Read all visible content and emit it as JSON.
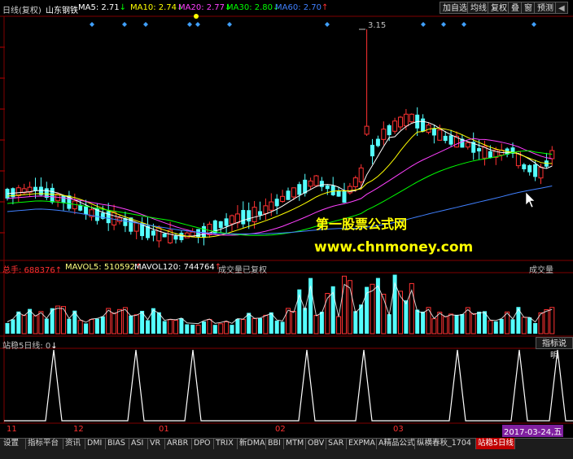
{
  "header": {
    "period": "日线(复权)",
    "stock_name": "山东钢铁",
    "ma": [
      {
        "label": "MA5: 2.71",
        "arrow": "↓",
        "color": "#ffffff"
      },
      {
        "label": "MA10: 2.74",
        "arrow": "↓",
        "color": "#ffff00"
      },
      {
        "label": "MA20: 2.77",
        "arrow": "↓",
        "color": "#ff40ff"
      },
      {
        "label": "MA30: 2.80",
        "arrow": "↓",
        "color": "#00ff00"
      },
      {
        "label": "MA60: 2.70",
        "arrow": "↑",
        "color": "#4080ff"
      }
    ],
    "buttons": [
      "加自选",
      "均线",
      "复权",
      "叠",
      "窗",
      "预测"
    ],
    "scroll_arrow": "◀"
  },
  "peak_label": "3.15",
  "watermark": {
    "line1": "第一股票公式网",
    "line2": "www.chnmoney.com"
  },
  "volume_panel": {
    "total": "总手: 688376",
    "total_arrow": "↑",
    "mavol5": "MAVOL5: 510592",
    "mavol5_arrow": "↑",
    "mavol120": "MAVOL120: 744764",
    "mavol120_arrow": "↑",
    "note": "成交量已复权",
    "right_label": "成交量"
  },
  "indicator_panel": {
    "label": "站稳5日线: 0",
    "arrow": "↓",
    "help_button": "指标说明"
  },
  "time_axis": {
    "labels": [
      "11",
      "12",
      "01",
      "02",
      "03"
    ],
    "current_date": "2017-03-24,五"
  },
  "tabs": [
    "设置",
    "指标平台",
    "资讯",
    "DMI",
    "BIAS",
    "ASI",
    "VR",
    "ARBR",
    "DPO",
    "TRIX",
    "新DMA",
    "BBI",
    "MTM",
    "OBV",
    "SAR",
    "EXPMA",
    "A精品公式",
    "纵横春秋_1704",
    "站稳5日线"
  ],
  "colors": {
    "up": "#ff3232",
    "down": "#54ffff",
    "grid": "#800000",
    "ma5": "#ffffff",
    "ma10": "#ffff00",
    "ma20": "#ff40ff",
    "ma30": "#00ff00",
    "ma60": "#4080ff",
    "signal": "#00ffff"
  }
}
